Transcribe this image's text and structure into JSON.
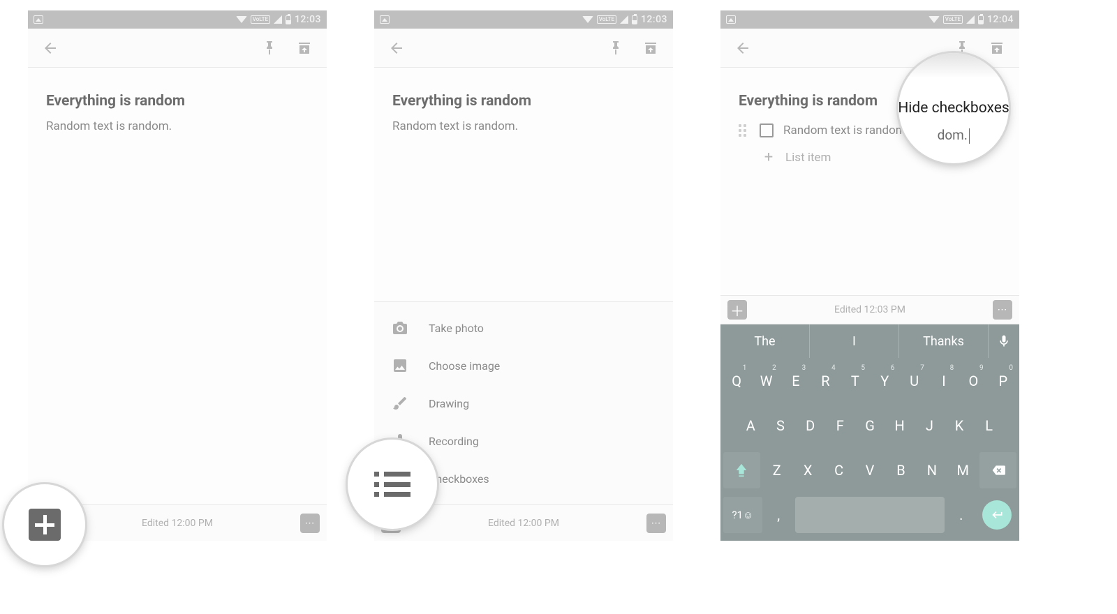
{
  "statusbar": {
    "volte": "VoLTE",
    "time_a": "12:03",
    "time_b": "12:04"
  },
  "note": {
    "title": "Everything is random",
    "body": "Random text is random.",
    "list_placeholder": "List item"
  },
  "bottom": {
    "edited_1": "Edited 12:00 PM",
    "edited_2": "Edited 12:00 PM",
    "edited_3": "Edited 12:03 PM"
  },
  "sheet": {
    "take_photo": "Take photo",
    "choose_image": "Choose image",
    "drawing": "Drawing",
    "recording": "Recording",
    "checkboxes": "Checkboxes"
  },
  "callout3": {
    "hide": "Hide checkboxes",
    "dom": "dom."
  },
  "keyboard": {
    "suggestions": [
      "The",
      "I",
      "Thanks"
    ],
    "row1": [
      {
        "k": "Q",
        "n": "1"
      },
      {
        "k": "W",
        "n": "2"
      },
      {
        "k": "E",
        "n": "3"
      },
      {
        "k": "R",
        "n": "4"
      },
      {
        "k": "T",
        "n": "5"
      },
      {
        "k": "Y",
        "n": "6"
      },
      {
        "k": "U",
        "n": "7"
      },
      {
        "k": "I",
        "n": "8"
      },
      {
        "k": "O",
        "n": "9"
      },
      {
        "k": "P",
        "n": "0"
      }
    ],
    "row2": [
      "A",
      "S",
      "D",
      "F",
      "G",
      "H",
      "J",
      "K",
      "L"
    ],
    "row3": [
      "Z",
      "X",
      "C",
      "V",
      "B",
      "N",
      "M"
    ],
    "sym": "?1☺",
    "comma": ",",
    "period": "."
  }
}
